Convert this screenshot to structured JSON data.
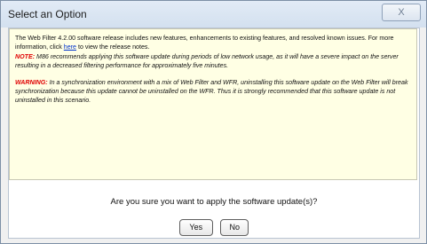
{
  "window": {
    "title": "Select an Option",
    "close_label": "X"
  },
  "notes": {
    "intro_before_link": "The Web Filter 4.2.00 software release includes new features, enhancements to existing features, and resolved known issues. For more information, click ",
    "link_text": "here",
    "intro_after_link": " to view the release notes.",
    "note_label": "NOTE:",
    "note_text": " M86 recommends applying this software update during periods of low network usage, as it will have a severe impact on the server resulting in a decreased filtering performance for approximately five minutes.",
    "warning_label": "WARNING:",
    "warning_text": " In a synchronization environment with a mix of Web Filter and WFR, uninstalling this software update on the Web Filter will break synchronization because this update cannot be uninstalled on the WFR. Thus it is strongly recommended that this software update is not uninstalled in this scenario."
  },
  "question": "Are you sure you want to apply the software update(s)?",
  "buttons": {
    "yes": "Yes",
    "no": "No"
  }
}
